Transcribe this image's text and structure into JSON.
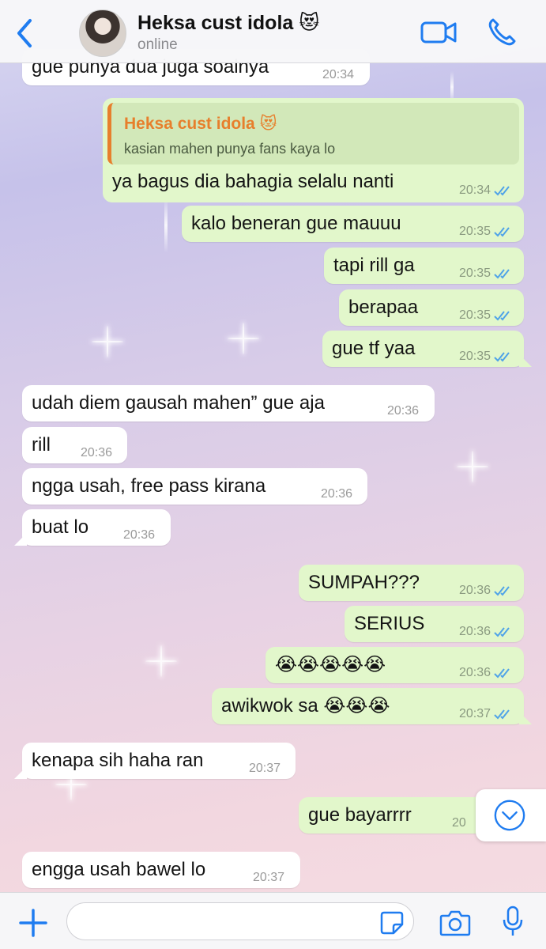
{
  "header": {
    "contact_name": "Heksa cust idola 😻",
    "status": "online"
  },
  "colors": {
    "accent_blue": "#1f7cf0",
    "outgoing_bubble": "#e2f7cb",
    "incoming_bubble": "#ffffff",
    "quote_author": "#e77f2c"
  },
  "icons": [
    "back-chevron-icon",
    "video-call-icon",
    "phone-icon",
    "read-ticks-icon",
    "chevron-down-icon",
    "plus-icon",
    "sticker-icon",
    "camera-icon",
    "microphone-icon"
  ],
  "messages": [
    {
      "text": "gue punya dua juga soalnya",
      "time": "20:34",
      "dir": "in"
    },
    {
      "text": "ya bagus dia bahagia selalu nanti",
      "time": "20:34",
      "dir": "out",
      "reply_to": {
        "author": "Heksa cust idola 😻",
        "text": "kasian mahen punya fans kaya lo"
      }
    },
    {
      "text": "kalo beneran gue mauuu",
      "time": "20:35",
      "dir": "out"
    },
    {
      "text": "tapi rill ga",
      "time": "20:35",
      "dir": "out"
    },
    {
      "text": "berapaa",
      "time": "20:35",
      "dir": "out"
    },
    {
      "text": "gue tf yaa",
      "time": "20:35",
      "dir": "out"
    },
    {
      "text": "udah diem gausah mahen” gue aja",
      "time": "20:36",
      "dir": "in"
    },
    {
      "text": "rill",
      "time": "20:36",
      "dir": "in"
    },
    {
      "text": "ngga usah, free pass kirana",
      "time": "20:36",
      "dir": "in"
    },
    {
      "text": "buat lo",
      "time": "20:36",
      "dir": "in"
    },
    {
      "text": "SUMPAH???",
      "time": "20:36",
      "dir": "out"
    },
    {
      "text": "SERIUS",
      "time": "20:36",
      "dir": "out"
    },
    {
      "text": "😭😭😭😭😭",
      "time": "20:36",
      "dir": "out"
    },
    {
      "text": "awikwok sa 😭😭😭",
      "time": "20:37",
      "dir": "out"
    },
    {
      "text": "kenapa sih haha ran",
      "time": "20:37",
      "dir": "in"
    },
    {
      "text": "gue bayarrrr",
      "time": "20",
      "dir": "out"
    },
    {
      "text": "engga usah bawel lo",
      "time": "20:37",
      "dir": "in"
    }
  ],
  "input": {
    "placeholder": ""
  }
}
